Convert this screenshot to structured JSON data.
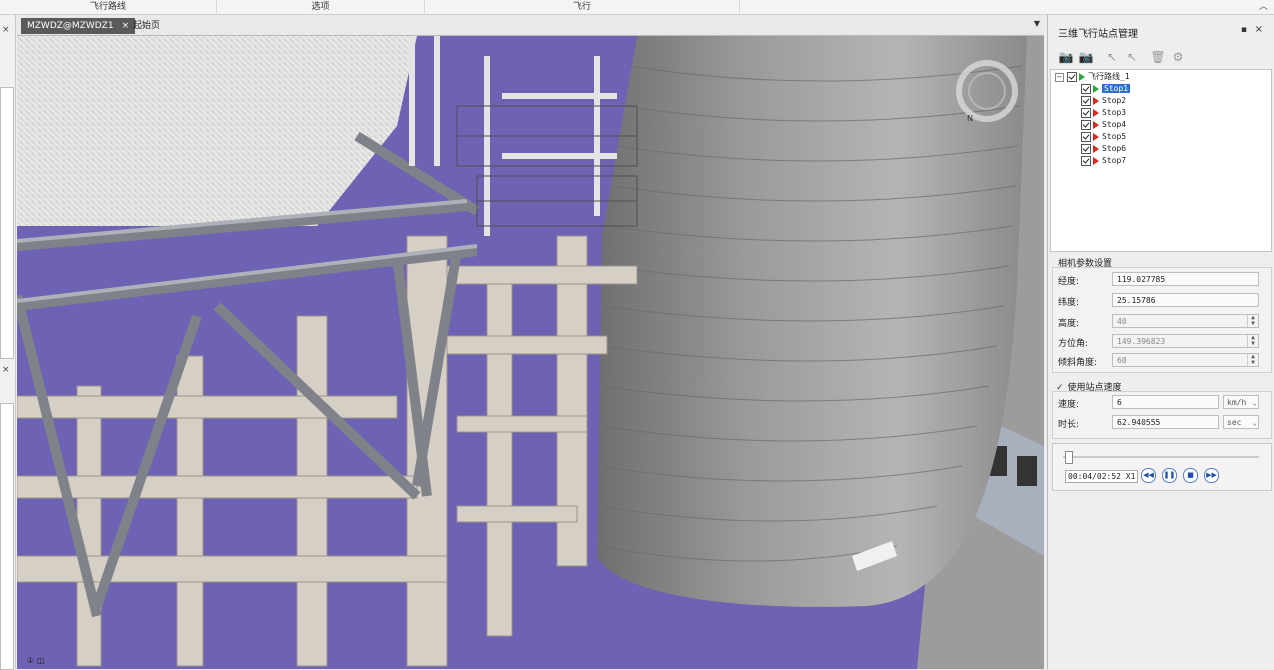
{
  "ribbon": {
    "groups": [
      "飞行路线",
      "选项",
      "飞行"
    ],
    "collapse_icon": "chevron-up-icon"
  },
  "left_strip": {
    "close_glyph": "×"
  },
  "document": {
    "tabs": [
      {
        "label": "MZWDZ@MZWDZ1",
        "active": true,
        "close": "×"
      },
      {
        "label": "起始页",
        "active": false
      }
    ],
    "tab_menu_glyph": "▼"
  },
  "viewport": {
    "description_icon": "compass-icon",
    "nav_hint": "① ◫"
  },
  "panel": {
    "title": "三维飞行站点管理",
    "pin_glyph": "▪",
    "close_glyph": "×",
    "toolbar": [
      {
        "name": "add-camera-icon",
        "glyph": "📷"
      },
      {
        "name": "update-camera-icon",
        "glyph": "📷"
      },
      {
        "name": "insert-stop-icon",
        "glyph": "↖"
      },
      {
        "name": "edit-stop-icon",
        "glyph": "↖"
      },
      {
        "name": "delete-icon",
        "glyph": "🗑"
      },
      {
        "name": "settings-icon",
        "glyph": "⚙"
      }
    ],
    "tree": {
      "root": {
        "label": "飞行路线_1",
        "expander": "−"
      },
      "stops": [
        {
          "label": "Stop1",
          "selected": true
        },
        {
          "label": "Stop2",
          "selected": false
        },
        {
          "label": "Stop3",
          "selected": false
        },
        {
          "label": "Stop4",
          "selected": false
        },
        {
          "label": "Stop5",
          "selected": false
        },
        {
          "label": "Stop6",
          "selected": false
        },
        {
          "label": "Stop7",
          "selected": false
        }
      ]
    },
    "camera": {
      "section_label": "相机参数设置",
      "longitude_label": "经度:",
      "longitude": "119.027785",
      "latitude_label": "纬度:",
      "latitude": "25.15786",
      "height_label": "高度:",
      "height": "40",
      "azimuth_label": "方位角:",
      "azimuth": "149.396823",
      "tilt_label": "倾斜角度:",
      "tilt": "60"
    },
    "speed": {
      "use_stop_speed_label": "使用站点速度",
      "use_stop_speed_checked": true,
      "speed_label": "速度:",
      "speed": "6",
      "speed_unit": "km/h",
      "duration_label": "时长:",
      "duration": "62.940555",
      "duration_unit": "sec"
    },
    "player": {
      "progress": 0.023,
      "time_text": "00:04/02:52 X1",
      "buttons": [
        {
          "name": "rewind-button",
          "glyph": "◀◀"
        },
        {
          "name": "pause-button",
          "glyph": "❚❚"
        },
        {
          "name": "stop-button",
          "glyph": "■"
        },
        {
          "name": "fast-forward-button",
          "glyph": "▶▶"
        }
      ]
    }
  }
}
